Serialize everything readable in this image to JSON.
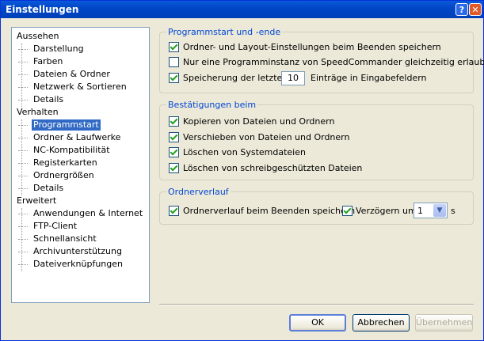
{
  "window": {
    "title": "Einstellungen",
    "help_label": "?",
    "close_label": "✕"
  },
  "tree": {
    "items": [
      {
        "label": "Aussehen",
        "level": 0
      },
      {
        "label": "Darstellung",
        "level": 1
      },
      {
        "label": "Farben",
        "level": 1
      },
      {
        "label": "Dateien & Ordner",
        "level": 1
      },
      {
        "label": "Netzwerk & Sortieren",
        "level": 1
      },
      {
        "label": "Details",
        "level": 1
      },
      {
        "label": "Verhalten",
        "level": 0
      },
      {
        "label": "Programmstart",
        "level": 1,
        "selected": true
      },
      {
        "label": "Ordner & Laufwerke",
        "level": 1
      },
      {
        "label": "NC-Kompatibilität",
        "level": 1
      },
      {
        "label": "Registerkarten",
        "level": 1
      },
      {
        "label": "Ordnergrößen",
        "level": 1
      },
      {
        "label": "Details",
        "level": 1
      },
      {
        "label": "Erweitert",
        "level": 0
      },
      {
        "label": "Anwendungen & Internet",
        "level": 1
      },
      {
        "label": "FTP-Client",
        "level": 1
      },
      {
        "label": "Schnellansicht",
        "level": 1
      },
      {
        "label": "Archivunterstützung",
        "level": 1
      },
      {
        "label": "Dateiverknüpfungen",
        "level": 1
      }
    ]
  },
  "start": {
    "title": "Programmstart und -ende",
    "save_layout": {
      "label": "Ordner- und Layout-Einstellungen beim Beenden  speichern",
      "checked": true
    },
    "single_instance": {
      "label": "Nur eine Programminstanz von SpeedCommander gleichzeitig erlaubt",
      "checked": false
    },
    "history": {
      "label_before": "Speicherung der letzten",
      "value": "10",
      "label_after": "Einträge in Eingabefeldern",
      "checked": true
    }
  },
  "confirm": {
    "title": "Bestätigungen beim",
    "items": [
      {
        "label": "Kopieren von Dateien und Ordnern",
        "checked": true
      },
      {
        "label": "Verschieben von Dateien und Ordnern",
        "checked": true
      },
      {
        "label": "Löschen von Systemdateien",
        "checked": true
      },
      {
        "label": "Löschen von schreibgeschützten Dateien",
        "checked": true
      }
    ]
  },
  "history_group": {
    "title": "Ordnerverlauf",
    "save": {
      "label": "Ordnerverlauf beim Beenden speichern",
      "checked": true
    },
    "delay": {
      "label": "Verzögern um",
      "checked": true,
      "value": "1",
      "unit": "s"
    }
  },
  "buttons": {
    "ok": "OK",
    "cancel": "Abbrechen",
    "apply": "Übernehmen"
  },
  "colors": {
    "accent": "#0046d5",
    "selection": "#316ac5",
    "titlebar": "#0047c8"
  }
}
